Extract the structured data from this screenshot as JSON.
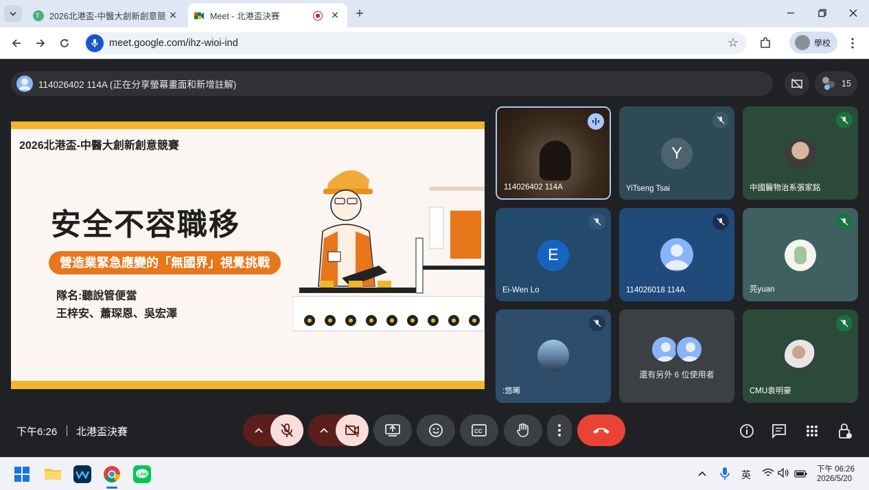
{
  "browser": {
    "tabs": [
      {
        "title": "2026北港盃-中醫大創新創意競",
        "active": false
      },
      {
        "title": "Meet - 北港盃決賽",
        "active": true
      }
    ],
    "url": "meet.google.com/ihz-wioi-ind",
    "profile_label": "學校"
  },
  "meet": {
    "presenter_text": "114026402 114A (正在分享螢幕畫面和新增註解)",
    "participant_count": "15",
    "slide": {
      "competition": "2026北港盃-中醫大創新創意競賽",
      "title": "安全不容職移",
      "subtitle": "營造業緊急應變的「無國界」視覺挑戰",
      "team": "隊名:聽說管便當",
      "members": "王梓安、蕭琛恩、吳宏澤"
    },
    "tiles": [
      {
        "name": "114026402 114A",
        "avatar": "camera",
        "speaking": true
      },
      {
        "name": "YiTseng Tsai",
        "avatar": "letter",
        "letter": "Y",
        "muted": true
      },
      {
        "name": "中國醫物治系張家銘",
        "avatar": "photo",
        "muted": true
      },
      {
        "name": "Ei-Wen Lo",
        "avatar": "letter",
        "letter": "E",
        "muted": true
      },
      {
        "name": "114026018 114A",
        "avatar": "person",
        "muted": true
      },
      {
        "name": "芫yuan",
        "avatar": "photo",
        "muted": true
      },
      {
        "name": ":悠晞",
        "avatar": "photo",
        "muted": true
      },
      {
        "name": "還有另外 6 位使用者",
        "avatar": "group"
      },
      {
        "name": "CMU袁明豪",
        "avatar": "photo",
        "muted": true
      }
    ],
    "time": "下午6:26",
    "meeting_name": "北港盃決賽"
  },
  "taskbar": {
    "ime": "英",
    "clock_period": "下午 06:26",
    "date": "2026/5/20"
  },
  "colors": {
    "end_call": "#ea4335",
    "slide_accent": "#e8761b",
    "slide_border": "#f0b62b",
    "tile_green": "#2b4a3a",
    "tile_blue": "#1f4a7a"
  }
}
